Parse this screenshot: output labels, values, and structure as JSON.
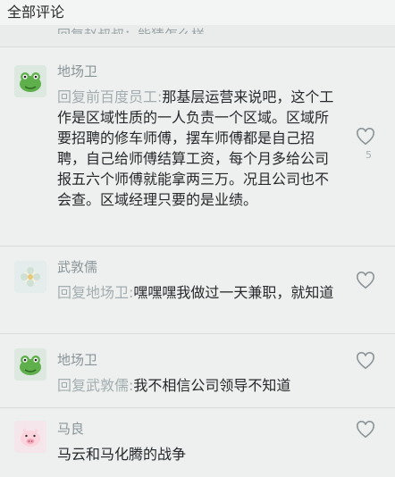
{
  "header": {
    "title": "全部评论"
  },
  "partial_reply": "回复赵叔叔：能猜怎么样",
  "comments": [
    {
      "name": "地场卫",
      "reply_prefix": "回复前百度员工:",
      "text": "那基层运营来说吧，这个工作是区域性质的一人负责一个区域。区域所要招聘的修车师傅，摆车师傅都是自己招聘，自己给师傅结算工资，每个月多给公司报五六个师傅就能拿两三万。况且公司也不会查。区域经理只要的是业绩。",
      "likes": "5"
    },
    {
      "name": "武敦儒",
      "reply_prefix": "回复地场卫:",
      "text": "嘿嘿嘿我做过一天兼职，就知道"
    },
    {
      "name": "地场卫",
      "reply_prefix": "回复武敦儒:",
      "text": "我不相信公司领导不知道"
    },
    {
      "name": "马良",
      "text": "马云和马化腾的战争"
    }
  ],
  "icons": {
    "like": "heart-outline-icon",
    "avatar_frog": "frog-avatar-icon",
    "avatar_flower": "flower-avatar-icon",
    "avatar_pig": "pig-avatar-icon"
  }
}
